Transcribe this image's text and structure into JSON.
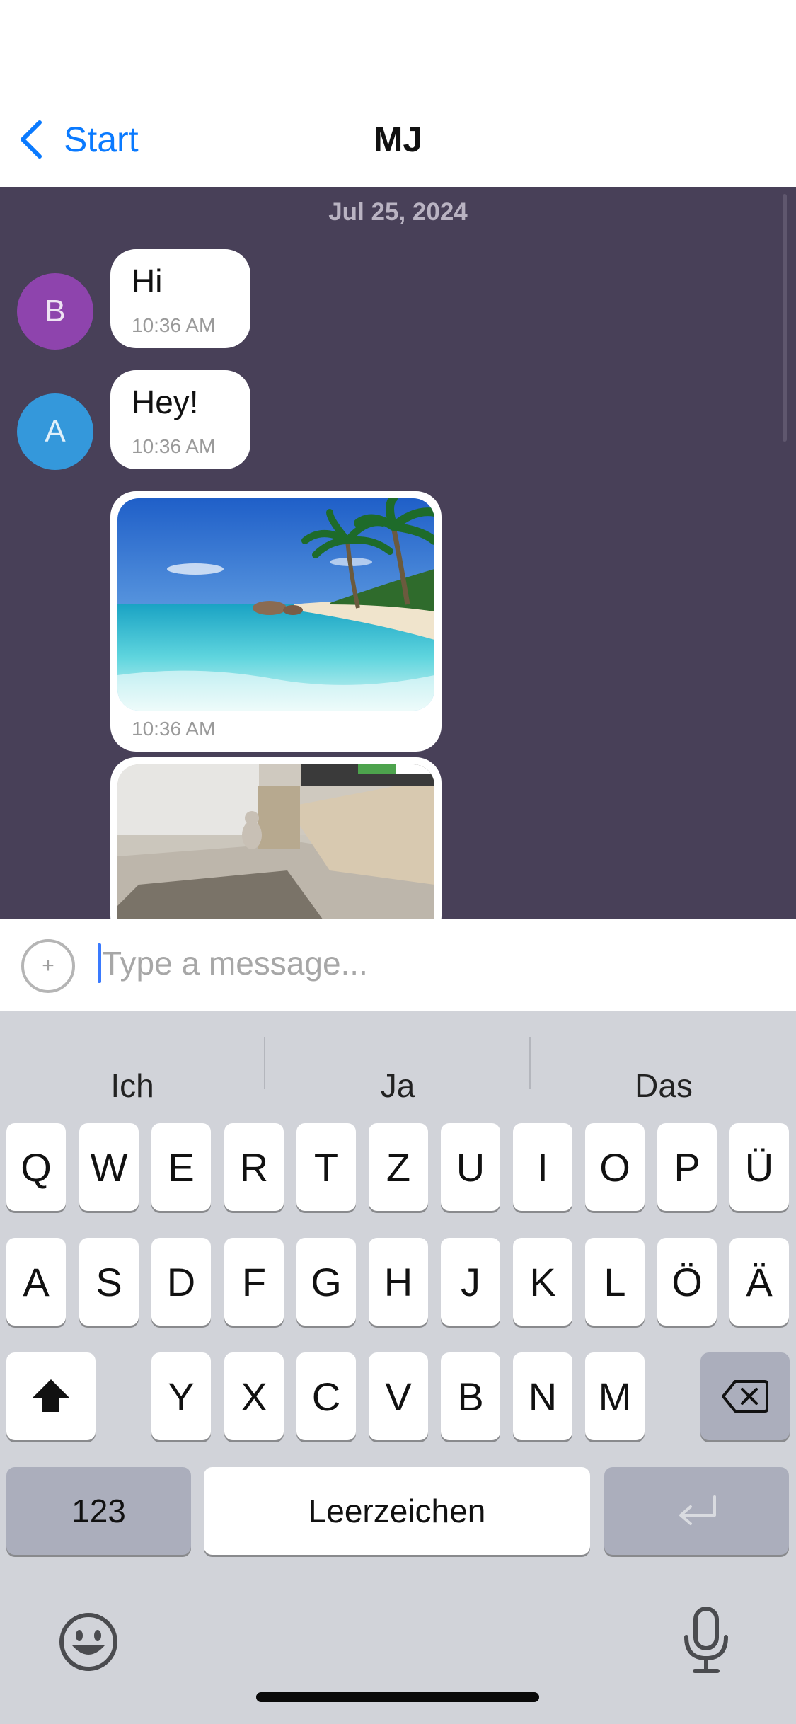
{
  "header": {
    "back_label": "Start",
    "title": "MJ"
  },
  "chat": {
    "date_label": "Jul 25, 2024",
    "messages": [
      {
        "avatar_letter": "B",
        "avatar_color": "#8E44AD",
        "text": "Hi",
        "time": "10:36 AM"
      },
      {
        "avatar_letter": "A",
        "avatar_color": "#3498DB",
        "text": "Hey!",
        "time": "10:36 AM"
      },
      {
        "type": "image",
        "image": "beach-photo",
        "time": "10:36 AM"
      },
      {
        "type": "image",
        "image": "room-with-cat-photo"
      }
    ]
  },
  "composer": {
    "placeholder": "Type a message...",
    "attach_icon": "plus-circle-icon"
  },
  "keyboard": {
    "suggestions": [
      "Ich",
      "Ja",
      "Das"
    ],
    "row1": [
      "Q",
      "W",
      "E",
      "R",
      "T",
      "Z",
      "U",
      "I",
      "O",
      "P",
      "Ü"
    ],
    "row2": [
      "A",
      "S",
      "D",
      "F",
      "G",
      "H",
      "J",
      "K",
      "L",
      "Ö",
      "Ä"
    ],
    "row3": [
      "Y",
      "X",
      "C",
      "V",
      "B",
      "N",
      "M"
    ],
    "numbers_label": "123",
    "space_label": "Leerzeichen",
    "icons": {
      "shift": "shift-icon",
      "delete": "delete-icon",
      "return": "return-icon",
      "emoji": "emoji-icon",
      "mic": "microphone-icon"
    }
  },
  "colors": {
    "accent": "#0A7AFF",
    "chat_background": "#484058",
    "keyboard_background": "#D1D3D9"
  }
}
